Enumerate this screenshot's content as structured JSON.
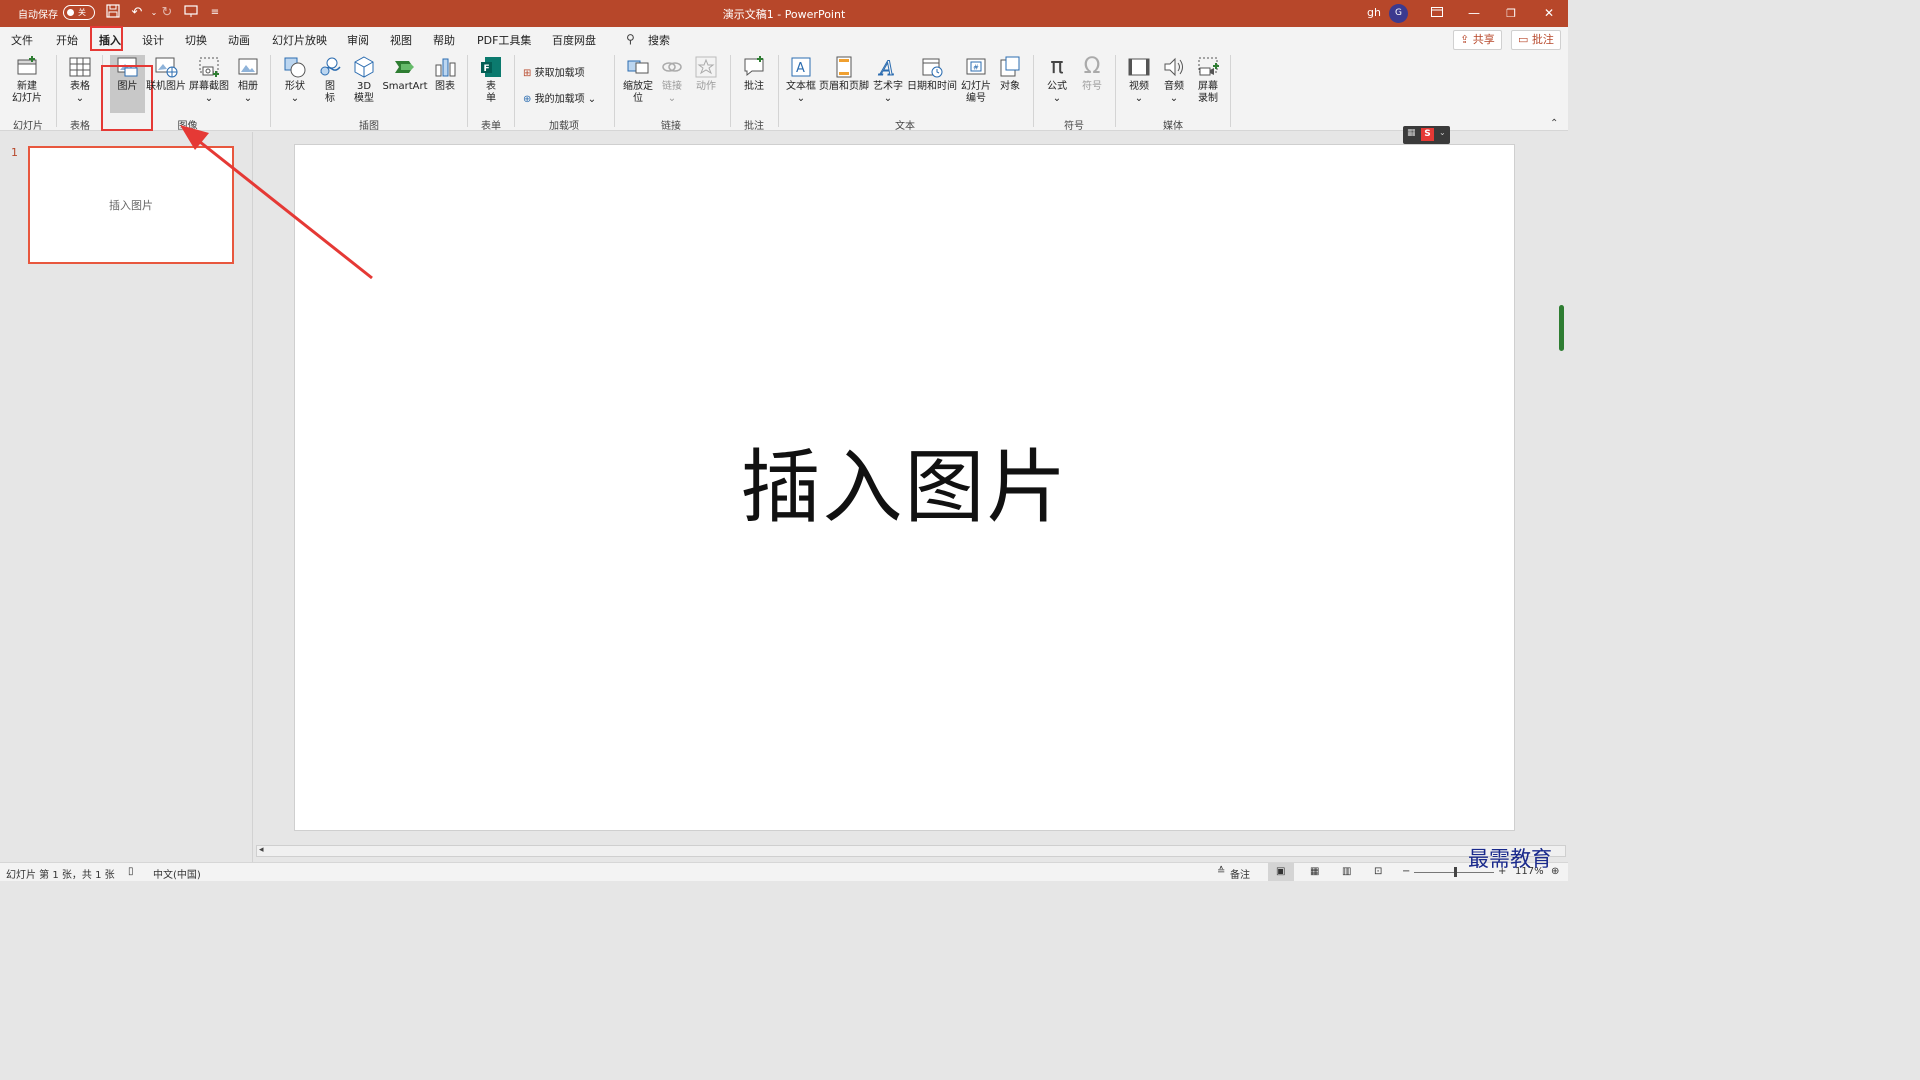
{
  "titlebar": {
    "autosave_label": "自动保存",
    "autosave_state": "关",
    "document_title": "演示文稿1  -  PowerPoint",
    "user_name": "gh",
    "avatar_initial": "G"
  },
  "tabs": [
    "文件",
    "开始",
    "插入",
    "设计",
    "切换",
    "动画",
    "幻灯片放映",
    "审阅",
    "视图",
    "帮助",
    "PDF工具集",
    "百度网盘"
  ],
  "active_tab": "插入",
  "search_label": "搜索",
  "share_label": "共享",
  "comments_label": "批注",
  "ribbon": {
    "new_slide": "新建\n幻灯片",
    "table": "表格",
    "pictures": "图片",
    "online_pictures": "联机图片",
    "screenshot": "屏幕截图",
    "photo_album": "相册",
    "shapes": "形状",
    "icons": "图\n标",
    "models_3d": "3D\n模型",
    "smartart": "SmartArt",
    "chart": "图表",
    "forms": "表\n单",
    "get_addins": "获取加载项",
    "my_addins": "我的加载项",
    "zoom": "缩放定\n位",
    "link": "链接",
    "action": "动作",
    "comment": "批注",
    "textbox": "文本框",
    "header_footer": "页眉和页脚",
    "wordart": "艺术字",
    "datetime": "日期和时间",
    "slide_number": "幻灯片\n编号",
    "object": "对象",
    "equation": "公式",
    "symbol": "符号",
    "video": "视频",
    "audio": "音频",
    "screen_recording": "屏幕\n录制",
    "groups": {
      "slides": "幻灯片",
      "tables": "表格",
      "images": "图像",
      "illustrations": "插图",
      "forms": "表单",
      "addins": "加载项",
      "links": "链接",
      "comments": "批注",
      "text": "文本",
      "symbols": "符号",
      "media": "媒体"
    }
  },
  "thumbnail": {
    "number": "1",
    "text": "插入图片"
  },
  "slide": {
    "text": "插入图片"
  },
  "statusbar": {
    "slide_info": "幻灯片 第 1 张，共 1 张",
    "language": "中文(中国)",
    "notes": "备注",
    "zoom": "117%"
  },
  "watermark": "最需教育",
  "colors": {
    "accent": "#b7472a",
    "highlight": "#e53935"
  }
}
